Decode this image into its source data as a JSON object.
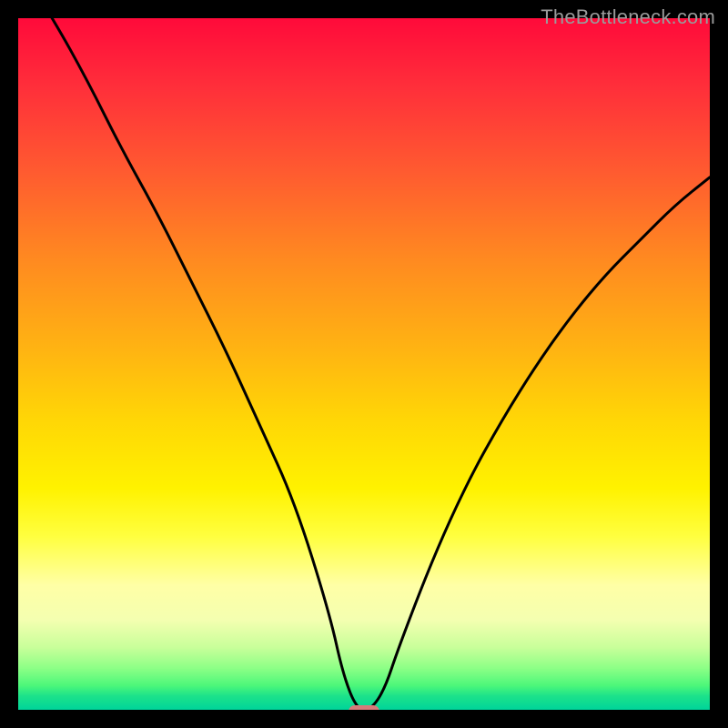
{
  "watermark": "TheBottleneck.com",
  "chart_data": {
    "type": "line",
    "title": "",
    "xlabel": "",
    "ylabel": "",
    "xlim": [
      0,
      100
    ],
    "ylim": [
      0,
      100
    ],
    "grid": false,
    "series": [
      {
        "name": "bottleneck-curve",
        "x": [
          0,
          5,
          10,
          15,
          20,
          25,
          30,
          35,
          40,
          45,
          47,
          49,
          51,
          53,
          55,
          60,
          65,
          70,
          75,
          80,
          85,
          90,
          95,
          100
        ],
        "values": [
          108,
          100,
          91,
          81,
          72,
          62,
          52,
          41,
          30,
          14,
          5,
          0,
          0,
          3,
          9,
          22,
          33,
          42,
          50,
          57,
          63,
          68,
          73,
          77
        ]
      }
    ],
    "marker": {
      "x": 50,
      "y": 0,
      "color": "#d57a7a"
    },
    "background_gradient": [
      {
        "pos": 0.0,
        "color": "#ff0a3a"
      },
      {
        "pos": 0.35,
        "color": "#ff8a20"
      },
      {
        "pos": 0.68,
        "color": "#fff200"
      },
      {
        "pos": 0.88,
        "color": "#f4ffb0"
      },
      {
        "pos": 1.0,
        "color": "#00d49a"
      }
    ]
  }
}
